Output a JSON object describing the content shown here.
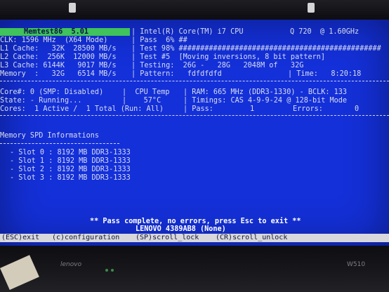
{
  "header": {
    "banner": "Memtest86  5.01",
    "cpu": "| Intel(R) Core(TM) i7 CPU",
    "cpu_speed": "Q 720  @ 1.60GHz",
    "clk": "CLK: 1596 MHz  (X64 Mode)",
    "pass": "| Pass  6% ##",
    "l1": "L1 Cache:   32K  28500 MB/s",
    "test_pct": "| Test 98% ###############################################",
    "l2": "L2 Cache:  256K  12000 MB/s",
    "test_no": "| Test #5  [Moving inversions, 8 bit pattern]",
    "l3": "L3 Cache: 6144K   9017 MB/s",
    "testing": "| Testing:  26G -   28G   2048M of   32G",
    "memory": "Memory  :   32G   6514 MB/s",
    "pattern": "| Pattern:   fdfdfdfd",
    "time": "| Time:   8:20:18"
  },
  "status": {
    "core": "Core#: 0 (SMP: Disabled)",
    "cpu_temp_label": "|  CPU Temp",
    "ram": "| RAM: 665 MHz (DDR3-1330) - BCLK: 133",
    "state": "State: - Running...",
    "cpu_temp_value": "|    57°C",
    "timings": "| Timings: CAS 4-9-9-24 @ 128-bit Mode",
    "cores": "Cores:  1 Active /  1 Total (Run: All)",
    "pass_label": "| Pass:",
    "pass_value": "1",
    "errors_label": "Errors:",
    "errors_value": "0"
  },
  "spd": {
    "title": "Memory SPD Informations",
    "slots": [
      "- Slot 0 : 8192 MB DDR3-1333",
      "- Slot 1 : 8192 MB DDR3-1333",
      "- Slot 2 : 8192 MB DDR3-1333",
      "- Slot 3 : 8192 MB DDR3-1333"
    ]
  },
  "footer": {
    "message": "** Pass complete, no errors, press Esc to exit **",
    "machine": "LENOVO 4389AB8 (None)",
    "keys": {
      "exit": "(ESC)exit",
      "config": "(c)configuration",
      "scroll_lock": "(SP)scroll_lock",
      "scroll_unlock": "(CR)scroll_unlock"
    }
  },
  "bezel": {
    "brand_left": "lenovo",
    "brand_right": "W510"
  },
  "colors": {
    "screen": "#1430d8",
    "banner": "#3fc35a",
    "statusbar": "#d8d8dc"
  }
}
